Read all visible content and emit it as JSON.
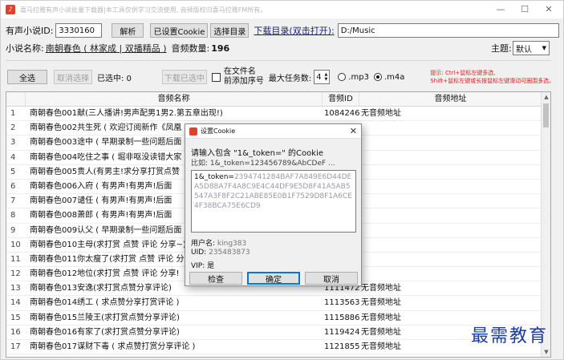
{
  "window": {
    "title": "喜马拉雅有声小说批量下载器|本工具仅供学习交流使用, 音频版权归喜马拉雅FM所有。",
    "controls": [
      "—",
      "☐",
      "✕"
    ]
  },
  "top": {
    "novel_id_label": "有声小说ID:",
    "novel_id_value": "3330160",
    "parse_button": "解析",
    "cookie_button": "已设置Cookie",
    "choose_dir_button": "选择目录",
    "download_dir_label": "下载目录(双击打开):",
    "download_dir_value": "D:/Music"
  },
  "info": {
    "novel_name_label": "小说名称:",
    "novel_name_value": "南朝春色 ( 林家成 | 双播精品 )",
    "audio_count_label": "音频数量:",
    "audio_count_value": "196",
    "theme_label": "主题:",
    "theme_value": "默认"
  },
  "toolbar": {
    "select_all": "全选",
    "cancel_select": "取消选择",
    "selected_label": "已选中: 0",
    "download_selected": "下载已选中",
    "prefix_index_line1": "在文件名",
    "prefix_index_line2": "前添加序号",
    "max_tasks_label": "最大任务数:",
    "max_tasks_value": "4",
    "format_mp3": ".mp3",
    "format_m4a": ".m4a",
    "hint_line1": "提示: Ctrl+鼠标左键多选,",
    "hint_line2": "Shift+鼠标左键或长按鼠标左键滑动可圈围多选。"
  },
  "table": {
    "headers": [
      "",
      "音频名称",
      "音频ID",
      "音频地址"
    ],
    "rows": [
      {
        "no": "1",
        "name": "南朝春色001献(三人播讲!男声配男1男2.第五章出现!)",
        "id": "10842467",
        "addr": "无音频地址"
      },
      {
        "no": "2",
        "name": "南朝春色002共生死 ( 欢迎订阅新作《凤凰",
        "id": "",
        "addr": ""
      },
      {
        "no": "3",
        "name": "南朝春色003途中 ( 早期录制一些问题后面",
        "id": "",
        "addr": ""
      },
      {
        "no": "4",
        "name": "南朝春色004吃住之事 ( 堀非呕没读错大家",
        "id": "",
        "addr": ""
      },
      {
        "no": "5",
        "name": "南朝春色005贵人(有男主!求分享打赏点赞",
        "id": "",
        "addr": ""
      },
      {
        "no": "6",
        "name": "南朝春色006入府 ( 有男声!有男声!后面",
        "id": "",
        "addr": ""
      },
      {
        "no": "7",
        "name": "南朝春色007谴任 ( 有男声!有男声!后面",
        "id": "",
        "addr": ""
      },
      {
        "no": "8",
        "name": "南朝春色008萧郎 ( 有男声!有男声!后面",
        "id": "",
        "addr": ""
      },
      {
        "no": "9",
        "name": "南朝春色009认父 ( 早期录制一些问题后面",
        "id": "",
        "addr": ""
      },
      {
        "no": "10",
        "name": "南朝春色010主母(求打赏 点赞 评论 分享~)",
        "id": "",
        "addr": ""
      },
      {
        "no": "11",
        "name": "南朝春色011你太瘦了(求打赏 点赞 评论 分",
        "id": "",
        "addr": ""
      },
      {
        "no": "12",
        "name": "南朝春色012地位(求打赏 点赞 评论 分享!",
        "id": "",
        "addr": ""
      },
      {
        "no": "13",
        "name": "南朝春色013安逸(求打赏点赞分享评论)",
        "id": "11114726",
        "addr": "无音频地址"
      },
      {
        "no": "14",
        "name": "南朝春色014绣工 ( 求点赞分享打赏评论 )",
        "id": "11135637",
        "addr": "无音频地址"
      },
      {
        "no": "15",
        "name": "南朝春色015兰陵王(求打赏点赞分享评论)",
        "id": "11158866",
        "addr": "无音频地址"
      },
      {
        "no": "16",
        "name": "南朝春色016有家了(求打赏点赞分享评论)",
        "id": "11194245",
        "addr": "无音频地址"
      },
      {
        "no": "17",
        "name": "南朝春色017谋财下毒 ( 求点赞打赏分享评论 )",
        "id": "11218554",
        "addr": "无音频地址"
      }
    ],
    "row_ids_hidden": [
      "无音频地址"
    ]
  },
  "dialog": {
    "title": "设置Cookie",
    "close": "✕",
    "prompt": "请输入包含 \"1&_token=\" 的Cookie",
    "example": "比如: 1&_token=123456789&AbCDeF ...",
    "text_prefix": "1&_token=",
    "text_masked": "2394741284BAF7A849E6D44DEA5D88A7F4A8C9E4C44DF9E5D8F41A5AB5547A3F8F2C21ABE85E0B1F7529D8F1A6CE4F38BCA75E6CD9",
    "user_label": "用户名:",
    "user_value": "king383",
    "uid_label": "UID:",
    "uid_value": "235483873",
    "vip_label": "VIP:",
    "vip_value": "是",
    "btn_check": "检查",
    "btn_ok": "确定",
    "btn_cancel": "取消"
  },
  "watermark": "最需教育"
}
